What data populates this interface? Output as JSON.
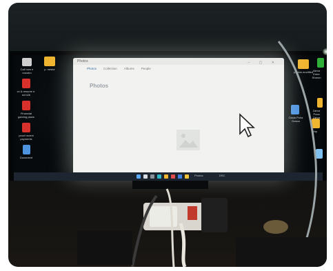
{
  "photo": {
    "subject": "Monitor on a desk showing a Windows desktop with a Photos app window",
    "colors": {
      "screen_glow": "#f2f3f0",
      "background": "#0f1213",
      "taskbar": "#1c2530",
      "accent": "#3a6ea5"
    }
  },
  "desktop": {
    "left_icons": [
      {
        "icon": "game-app-icon",
        "label": "Call now e nosotro"
      },
      {
        "icon": "folder-icon",
        "label": "p. nestor"
      },
      {
        "icon": "pdf-file-icon",
        "label": "cv & resume e. ed b2b"
      },
      {
        "icon": "pdf-file-icon",
        "label": "Financial gaming plans"
      },
      {
        "icon": "pdf-file-icon",
        "label": "proof recent payments"
      },
      {
        "icon": "word-file-icon",
        "label": "Document"
      }
    ],
    "right_icons": [
      {
        "icon": "folder-icon",
        "label": "photos modified"
      },
      {
        "icon": "green-app-icon",
        "label": "Alexa Entre Sharon"
      },
      {
        "icon": "word-file-icon",
        "label": "Ossia Poha Dosca"
      },
      {
        "icon": "folder-icon",
        "label": "Zahra Poca Zahra"
      },
      {
        "icon": "folder-icon",
        "label": "Ship"
      }
    ]
  },
  "window": {
    "title": "Photos",
    "tabs": [
      "Photos",
      "Collection",
      "Albums",
      "People"
    ],
    "heading": "Photos"
  },
  "taskbar": {
    "items": [
      "start",
      "search",
      "task-view",
      "edge",
      "explorer",
      "store",
      "photos",
      "chrome"
    ],
    "open_app": "Photos",
    "open_file": "DSC"
  }
}
